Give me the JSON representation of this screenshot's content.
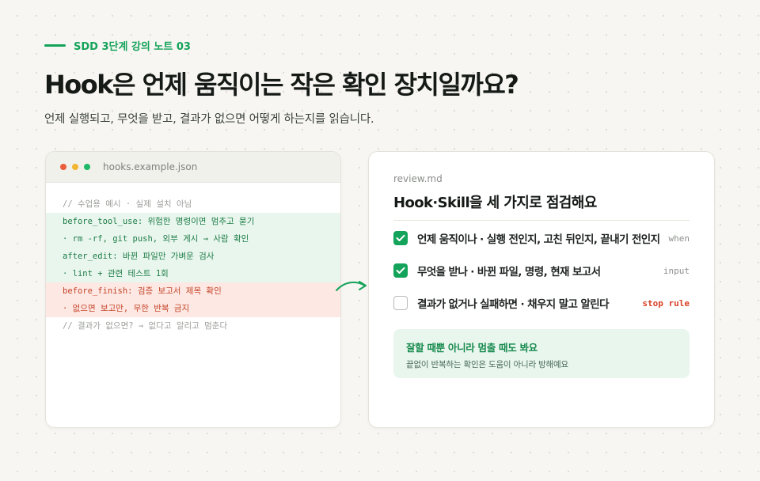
{
  "header": {
    "eyebrow": "SDD 3단계 강의 노트 03",
    "title": "Hook은 언제 움직이는 작은 확인 장치일까요?",
    "subtitle": "언제 실행되고, 무엇을 받고, 결과가 없으면 어떻게 하는지를 읽습니다."
  },
  "code_window": {
    "filename": "hooks.example.json",
    "lines": [
      {
        "text": "// 수업용 예시 · 실제 설치 아님"
      },
      {
        "key": "before_tool_use:",
        "rest": " 위험한 명령이면 멈추고 묻기"
      },
      {
        "text": "· rm -rf, git push, 외부 게시 → 사람 확인"
      },
      {
        "key": "after_edit:",
        "rest": " 바뀐 파일만 가벼운 검사"
      },
      {
        "text": "· lint + 관련 테스트 1회"
      },
      {
        "key": "before_finish:",
        "rest": " 검증 보고서 제목 확인"
      },
      {
        "text": "· 없으면 보고만, 무한 반복 금지"
      },
      {
        "text": "// 결과가 없으면? → 없다고 알리고 멈춘다"
      }
    ]
  },
  "review": {
    "filename": "review.md",
    "heading": "Hook·Skill을 세 가지로 점검해요",
    "items": [
      {
        "label": "언제 움직이나 · 실행 전인지, 고친 뒤인지, 끝내기 전인지",
        "tag": "when",
        "checked": true
      },
      {
        "label": "무엇을 받나 · 바뀐 파일, 명령, 현재 보고서",
        "tag": "input",
        "checked": true
      },
      {
        "label": "결과가 없거나 실패하면 · 채우지 말고 알린다",
        "tag": "stop rule",
        "checked": false
      }
    ],
    "note": {
      "title": "잘할 때뿐 아니라 멈출 때도 봐요",
      "body": "끝없이 반복하는 확인은 도움이 아니라 방해예요"
    }
  },
  "colors": {
    "accent": "#14a35a",
    "danger": "#d94228",
    "background": "#f7f6f2"
  }
}
